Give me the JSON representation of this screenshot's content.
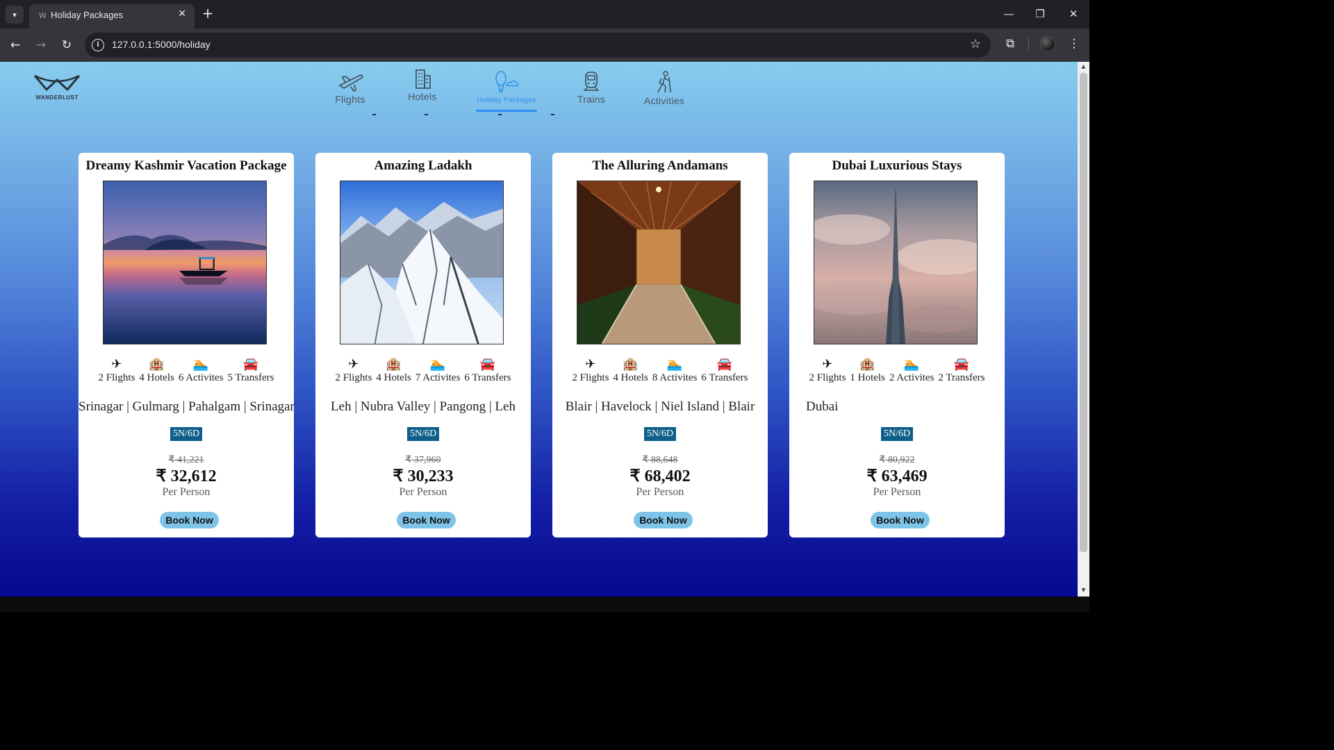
{
  "browser": {
    "tab_title": "Holiday Packages",
    "url": "127.0.0.1:5000/holiday",
    "icons": [
      "tab-dropdown-icon",
      "close-icon",
      "plus-icon",
      "minimize-icon",
      "restore-icon",
      "back-icon",
      "forward-icon",
      "reload-icon",
      "info-icon",
      "star-icon",
      "extensions-icon",
      "more-icon"
    ]
  },
  "logo": {
    "text": "WANDERLUST"
  },
  "nav": {
    "items": [
      {
        "label": "Flights",
        "icon": "airplane-icon"
      },
      {
        "label": "Hotels",
        "icon": "building-icon"
      },
      {
        "label": "Holiday Packages",
        "icon": "balloon-icon",
        "active": true
      },
      {
        "label": "Trains",
        "icon": "train-icon"
      },
      {
        "label": "Activities",
        "icon": "hiking-icon"
      }
    ]
  },
  "packages": [
    {
      "title": "Dreamy Kashmir Vacation Package",
      "flights": "2 Flights",
      "hotels": "4 Hotels",
      "activities": "6 Activites",
      "transfers": "5 Transfers",
      "route": "Srinagar | Gulmarg | Pahalgam | Srinagar",
      "duration": "5N/6D",
      "old_price": "₹ 41,221",
      "price": "₹ 32,612",
      "per": "Per Person",
      "button": "Book Now"
    },
    {
      "title": "Amazing Ladakh",
      "flights": "2 Flights",
      "hotels": "4 Hotels",
      "activities": "7 Activites",
      "transfers": "6 Transfers",
      "route": "Leh | Nubra Valley | Pangong | Leh",
      "duration": "5N/6D",
      "old_price": "₹ 37,960",
      "price": "₹ 30,233",
      "per": "Per Person",
      "button": "Book Now"
    },
    {
      "title": "The Alluring Andamans",
      "flights": "2 Flights",
      "hotels": "4 Hotels",
      "activities": "8 Activites",
      "transfers": "6 Transfers",
      "route": "Blair | Havelock | Niel Island | Blair",
      "duration": "5N/6D",
      "old_price": "₹ 88,648",
      "price": "₹ 68,402",
      "per": "Per Person",
      "button": "Book Now"
    },
    {
      "title": "Dubai Luxurious Stays",
      "flights": "2 Flights",
      "hotels": "1 Hotels",
      "activities": "2 Activites",
      "transfers": "2 Transfers",
      "route": "Dubai",
      "duration": "5N/6D",
      "old_price": "₹ 80,922",
      "price": "₹ 63,469",
      "per": "Per Person",
      "button": "Book Now"
    }
  ],
  "colors": {
    "accent": "#2f8ff0",
    "duration_badge": "#0e5f8a",
    "book_button": "#7ec4e8"
  }
}
